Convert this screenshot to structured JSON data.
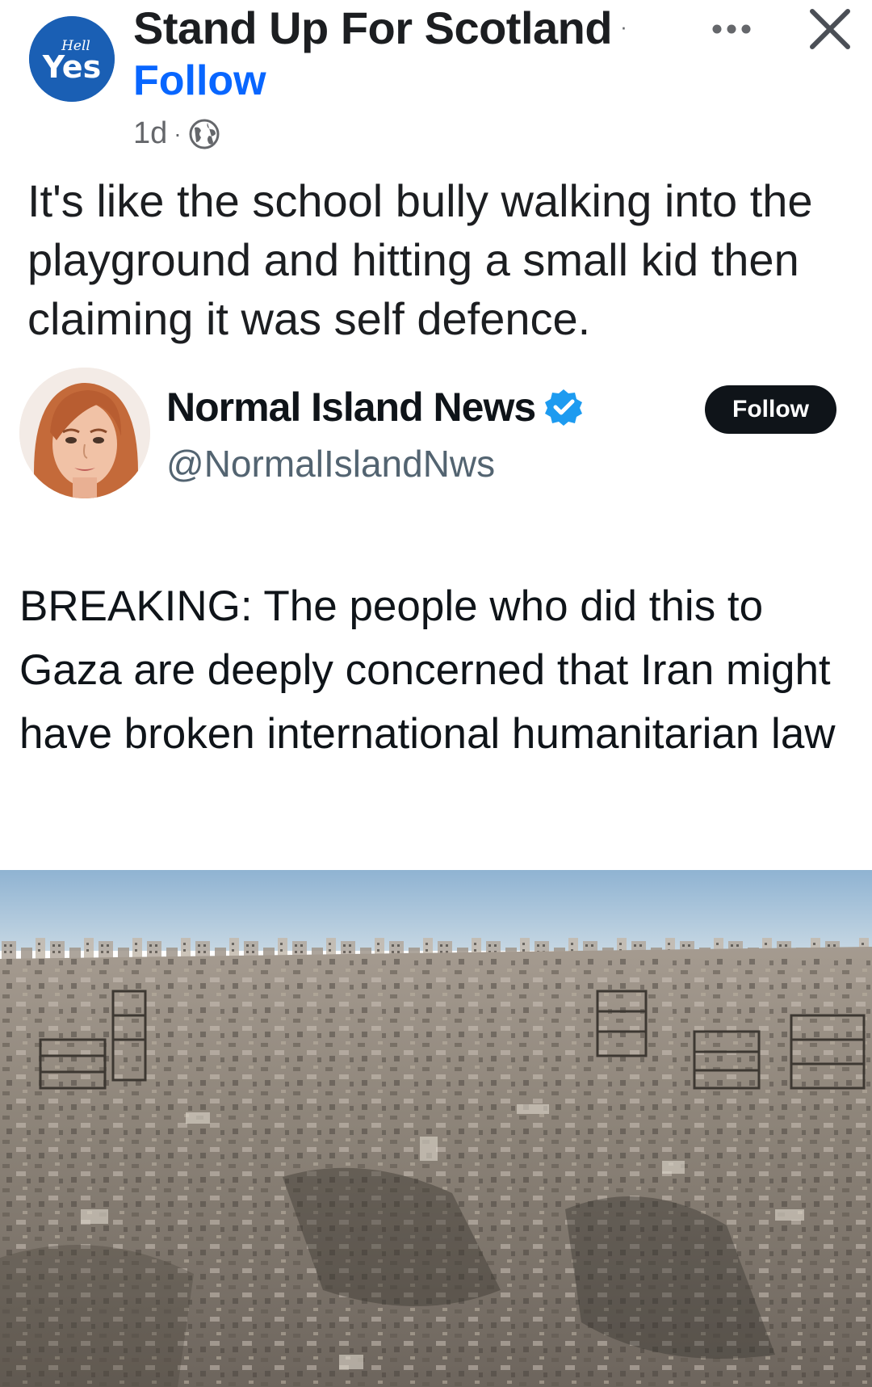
{
  "post": {
    "page_name": "Stand Up For Scotland",
    "separator": "·",
    "follow_label": "Follow",
    "time": "1d",
    "meta_separator": "·",
    "audience_icon": "globe-icon",
    "text": "It's like the school bully walking into the playground and hitting a small kid then claiming it was self defence.",
    "avatar": {
      "small_text": "Hell",
      "big_text": "Yes"
    }
  },
  "tweet": {
    "display_name": "Normal Island News",
    "handle": "@NormalIslandNws",
    "follow_label": "Follow",
    "verified_icon": "verified-badge-icon",
    "text": "BREAKING: The people who did this to Gaza are deeply concerned that Iran might have broken international humanitarian law",
    "image_description_icon": "rubble-photo"
  },
  "colors": {
    "facebook_blue": "#0866ff",
    "verified_blue": "#1d9bf0",
    "follow_button": "#0f1419"
  }
}
